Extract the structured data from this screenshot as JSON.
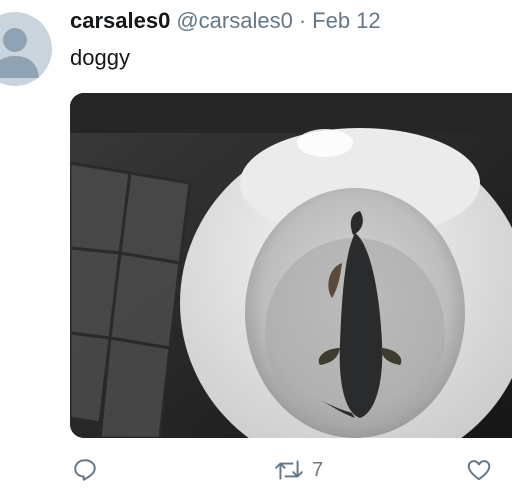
{
  "tweet": {
    "display_name": "carsales0",
    "handle": "@carsales0",
    "separator": "·",
    "date": "Feb 12",
    "text": "doggy"
  },
  "media": {
    "description": "Photo of a catfish swimming in a toilet bowl"
  },
  "actions": {
    "reply_icon": "reply-icon",
    "retweet_icon": "retweet-icon",
    "retweet_count": "7",
    "like_icon": "heart-icon"
  },
  "colors": {
    "text": "#14171a",
    "muted": "#657786",
    "avatar_bg": "#c9d4dd",
    "avatar_fg": "#8fa3b3"
  }
}
